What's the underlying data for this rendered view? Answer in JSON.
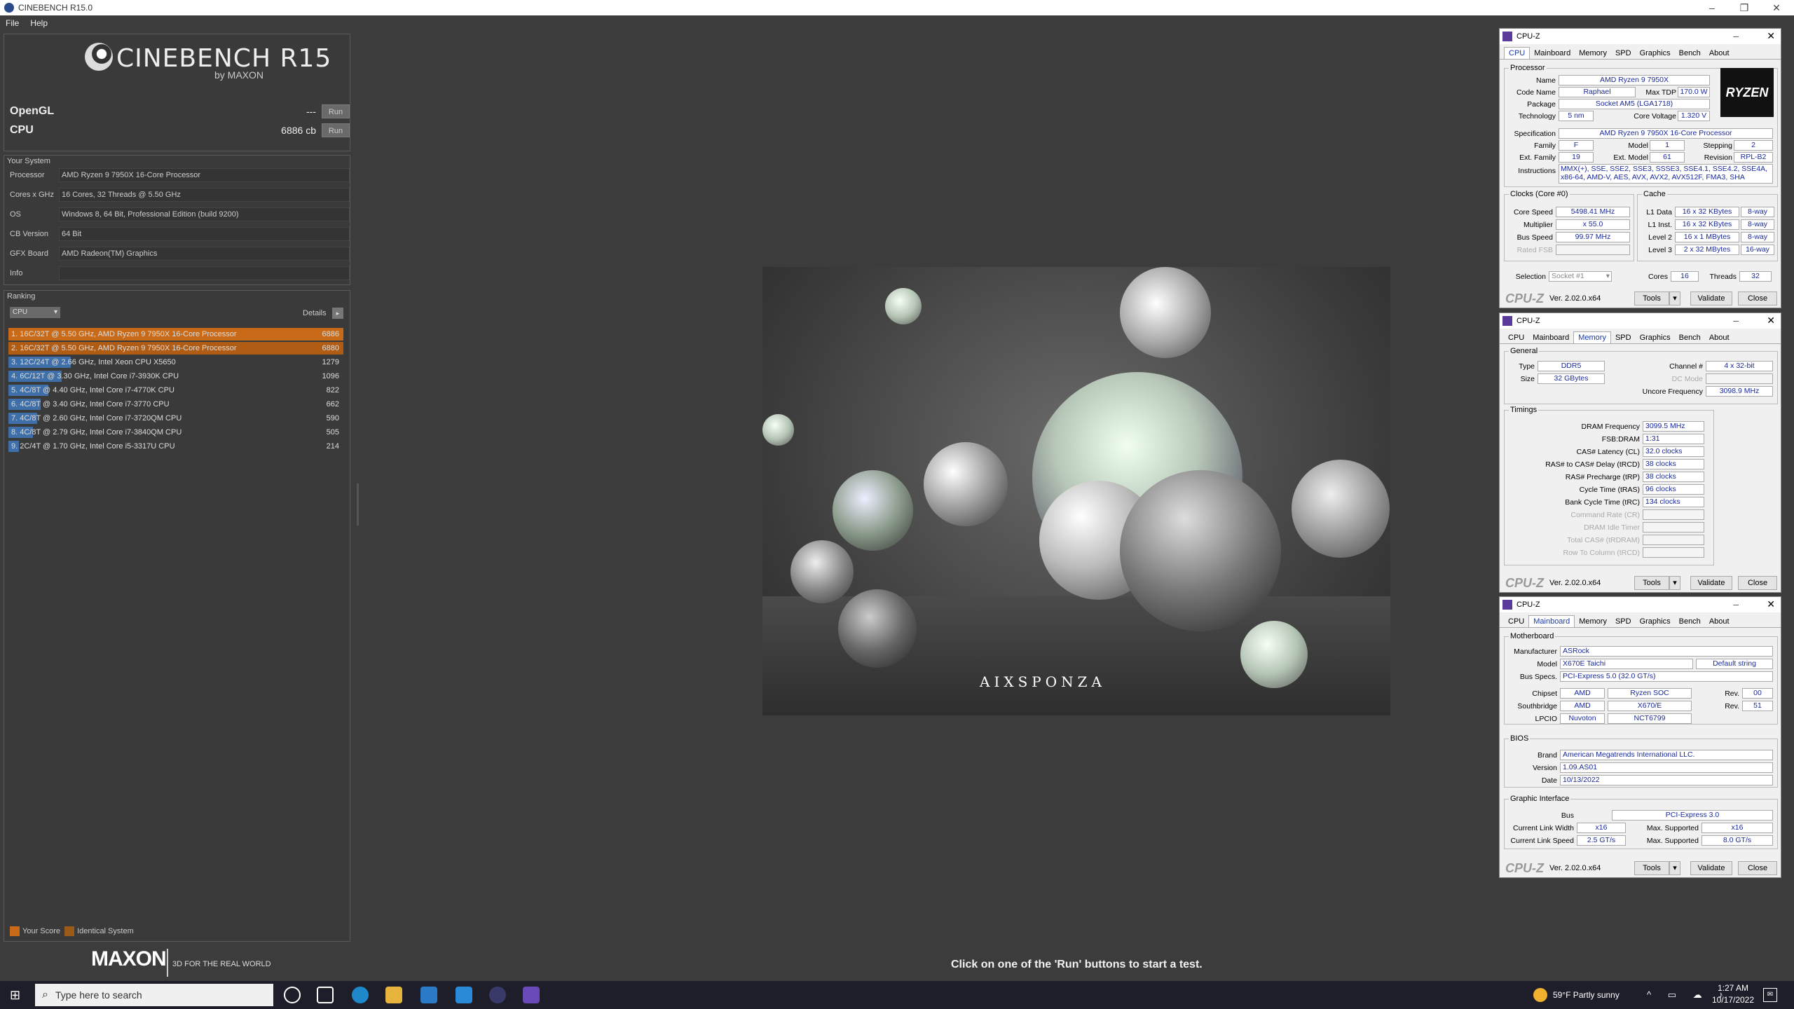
{
  "window": {
    "title": "CINEBENCH R15.0",
    "minimize": "–",
    "maximize": "❐",
    "close": "✕"
  },
  "menu": [
    "File",
    "Help"
  ],
  "logo": {
    "title": "CINEBENCH R15",
    "sub": "by MAXON"
  },
  "bench": {
    "opengl": {
      "label": "OpenGL",
      "value": "---",
      "run": "Run"
    },
    "cpu": {
      "label": "CPU",
      "value": "6886 cb",
      "run": "Run"
    }
  },
  "your_system": {
    "title": "Your System",
    "rows": [
      {
        "k": "Processor",
        "v": "AMD Ryzen 9 7950X 16-Core Processor"
      },
      {
        "k": "Cores x GHz",
        "v": "16 Cores, 32 Threads @ 5.50 GHz"
      },
      {
        "k": "OS",
        "v": "Windows 8, 64 Bit, Professional Edition (build 9200)"
      },
      {
        "k": "CB Version",
        "v": "64 Bit"
      },
      {
        "k": "GFX Board",
        "v": "AMD Radeon(TM) Graphics"
      },
      {
        "k": "Info",
        "v": ""
      }
    ]
  },
  "ranking": {
    "title": "Ranking",
    "dropdown": "CPU",
    "details": "Details",
    "rows": [
      {
        "text": "1. 16C/32T @ 5.50 GHz, AMD Ryzen 9 7950X 16-Core Processor",
        "score": "6886",
        "fill": 1.0
      },
      {
        "text": "2. 16C/32T @ 5.50 GHz, AMD Ryzen 9 7950X 16-Core Processor",
        "score": "6880",
        "fill": 1.0
      },
      {
        "text": "3. 12C/24T @ 2.66 GHz, Intel Xeon CPU X5650",
        "score": "1279",
        "fill": 0.186
      },
      {
        "text": "4. 6C/12T @ 3.30 GHz,  Intel Core i7-3930K CPU",
        "score": "1096",
        "fill": 0.159
      },
      {
        "text": "5. 4C/8T @ 4.40 GHz, Intel Core i7-4770K CPU",
        "score": "822",
        "fill": 0.119
      },
      {
        "text": "6. 4C/8T @ 3.40 GHz,  Intel Core i7-3770 CPU",
        "score": "662",
        "fill": 0.096
      },
      {
        "text": "7. 4C/8T @ 2.60 GHz, Intel Core i7-3720QM CPU",
        "score": "590",
        "fill": 0.086
      },
      {
        "text": "8. 4C/8T @ 2.79 GHz,  Intel Core i7-3840QM CPU",
        "score": "505",
        "fill": 0.073
      },
      {
        "text": "9. 2C/4T @ 1.70 GHz,  Intel Core i5-3317U CPU",
        "score": "214",
        "fill": 0.031
      }
    ],
    "legend": {
      "your_score": "Your Score",
      "identical": "Identical System"
    }
  },
  "footer": {
    "brand": "MAXON",
    "tagline": "3D FOR THE REAL WORLD"
  },
  "render": {
    "watermark": "AIXSPONZA"
  },
  "status": "Click on one of the 'Run' buttons to start a test.",
  "cpuz_common": {
    "title": "CPU-Z",
    "brand": "CPU-Z",
    "version": "Ver. 2.02.0.x64",
    "tools": "Tools",
    "validate": "Validate",
    "close": "Close",
    "tabs": [
      "CPU",
      "Mainboard",
      "Memory",
      "SPD",
      "Graphics",
      "Bench",
      "About"
    ]
  },
  "cpuz_cpu": {
    "processor_title": "Processor",
    "name": "AMD Ryzen 9 7950X",
    "code_name": "Raphael",
    "max_tdp": "170.0 W",
    "package": "Socket AM5 (LGA1718)",
    "technology": "5 nm",
    "core_voltage": "1.320 V",
    "specification": "AMD Ryzen 9 7950X 16-Core Processor",
    "family": "F",
    "model": "1",
    "stepping": "2",
    "ext_family": "19",
    "ext_model": "61",
    "revision": "RPL-B2",
    "instructions": "MMX(+), SSE, SSE2, SSE3, SSSE3, SSE4.1, SSE4.2, SSE4A, x86-64, AMD-V, AES, AVX, AVX2, AVX512F, FMA3, SHA",
    "clocks_title": "Clocks (Core #0)",
    "core_speed": "5498.41 MHz",
    "multiplier": "x 55.0",
    "bus_speed": "99.97 MHz",
    "rated_fsb": "",
    "cache_title": "Cache",
    "l1d": "16 x 32 KBytes",
    "l1d_way": "8-way",
    "l1i": "16 x 32 KBytes",
    "l1i_way": "8-way",
    "l2": "16 x 1 MBytes",
    "l2_way": "8-way",
    "l3": "2 x 32 MBytes",
    "l3_way": "16-way",
    "selection": "Socket #1",
    "cores": "16",
    "threads": "32",
    "logo": "RYZEN",
    "labels": {
      "name": "Name",
      "code_name": "Code Name",
      "max_tdp": "Max TDP",
      "package": "Package",
      "technology": "Technology",
      "core_voltage": "Core Voltage",
      "specification": "Specification",
      "family": "Family",
      "model": "Model",
      "stepping": "Stepping",
      "ext_family": "Ext. Family",
      "ext_model": "Ext. Model",
      "revision": "Revision",
      "instructions": "Instructions",
      "core_speed": "Core Speed",
      "multiplier": "Multiplier",
      "bus_speed": "Bus Speed",
      "rated_fsb": "Rated FSB",
      "l1d": "L1 Data",
      "l1i": "L1 Inst.",
      "l2": "Level 2",
      "l3": "Level 3",
      "selection": "Selection",
      "cores": "Cores",
      "threads": "Threads"
    }
  },
  "cpuz_mem": {
    "general_title": "General",
    "type": "DDR5",
    "size": "32 GBytes",
    "channel": "4 x 32-bit",
    "dc_mode": "",
    "uncore": "3098.9 MHz",
    "timings_title": "Timings",
    "timings": [
      {
        "k": "DRAM Frequency",
        "v": "3099.5 MHz",
        "dim": false
      },
      {
        "k": "FSB:DRAM",
        "v": "1:31",
        "dim": false
      },
      {
        "k": "CAS# Latency (CL)",
        "v": "32.0 clocks",
        "dim": false
      },
      {
        "k": "RAS# to CAS# Delay (tRCD)",
        "v": "38 clocks",
        "dim": false
      },
      {
        "k": "RAS# Precharge (tRP)",
        "v": "38 clocks",
        "dim": false
      },
      {
        "k": "Cycle Time (tRAS)",
        "v": "96 clocks",
        "dim": false
      },
      {
        "k": "Bank Cycle Time (tRC)",
        "v": "134 clocks",
        "dim": false
      },
      {
        "k": "Command Rate (CR)",
        "v": "",
        "dim": true
      },
      {
        "k": "DRAM Idle Timer",
        "v": "",
        "dim": true
      },
      {
        "k": "Total CAS# (tRDRAM)",
        "v": "",
        "dim": true
      },
      {
        "k": "Row To Column (tRCD)",
        "v": "",
        "dim": true
      }
    ],
    "labels": {
      "type": "Type",
      "size": "Size",
      "channel": "Channel #",
      "dc_mode": "DC Mode",
      "uncore": "Uncore Frequency"
    }
  },
  "cpuz_mb": {
    "motherboard_title": "Motherboard",
    "manufacturer": "ASRock",
    "model": "X670E Taichi",
    "model_extra": "Default string",
    "bus_specs": "PCI-Express 5.0 (32.0 GT/s)",
    "chipset_vendor": "AMD",
    "chipset": "Ryzen SOC",
    "chipset_rev": "00",
    "southbridge_vendor": "AMD",
    "southbridge": "X670/E",
    "southbridge_rev": "51",
    "lpcio_vendor": "Nuvoton",
    "lpcio": "NCT6799",
    "bios_title": "BIOS",
    "bios_brand": "American Megatrends International LLC.",
    "bios_version": "1.09.AS01",
    "bios_date": "10/13/2022",
    "gi_title": "Graphic Interface",
    "gi_bus": "PCI-Express 3.0",
    "link_width": "x16",
    "max_width": "x16",
    "link_speed": "2.5 GT/s",
    "max_speed": "8.0 GT/s",
    "labels": {
      "manufacturer": "Manufacturer",
      "model": "Model",
      "bus_specs": "Bus Specs.",
      "chipset": "Chipset",
      "southbridge": "Southbridge",
      "lpcio": "LPCIO",
      "rev": "Rev.",
      "brand": "Brand",
      "version": "Version",
      "date": "Date",
      "bus": "Bus",
      "link_width": "Current Link Width",
      "max_width": "Max. Supported",
      "link_speed": "Current Link Speed",
      "max_speed": "Max. Supported"
    }
  },
  "taskbar": {
    "search_placeholder": "Type here to search",
    "weather": "59°F  Partly sunny",
    "time": "1:27 AM",
    "date": "10/17/2022"
  }
}
